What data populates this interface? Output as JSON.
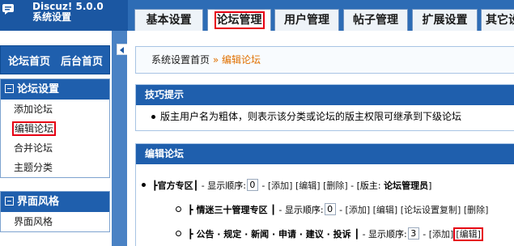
{
  "header": {
    "app_title": "Discuz! 5.0.0",
    "app_subtitle": "系统设置",
    "tabs": [
      {
        "label": "基本设置"
      },
      {
        "label": "论坛管理"
      },
      {
        "label": "用户管理"
      },
      {
        "label": "帖子管理"
      },
      {
        "label": "扩展设置"
      },
      {
        "label": "其它设"
      }
    ],
    "active_tab": "论坛管理"
  },
  "sidebar": {
    "links": [
      "论坛首页",
      "后台首页"
    ],
    "sections": [
      {
        "title": "论坛设置",
        "items": [
          "添加论坛",
          "编辑论坛",
          "合并论坛",
          "主题分类"
        ],
        "selected": "编辑论坛"
      },
      {
        "title": "界面风格",
        "items": [
          "界面风格"
        ]
      }
    ]
  },
  "main": {
    "breadcrumb": {
      "home": "系统设置首页",
      "separator": "»",
      "current": "编辑论坛"
    },
    "tip_panel": {
      "title": "技巧提示",
      "text": "版主用户名为粗体，则表示该分类或论坛的版主权限可继承到下级论坛"
    },
    "forum_panel": {
      "title": "编辑论坛",
      "rows": [
        {
          "name": "┣官方专区┃",
          "order_label": " - 显示顺序:",
          "order": "0",
          "actions": [
            "[添加]",
            "[编辑]",
            "[删除]"
          ],
          "mod_prefix": " - [版主: ",
          "mod_name": "论坛管理员",
          "mod_suffix": "]"
        },
        {
          "name": "┣ 情迷三十管理专区 ┃",
          "order_label": " - 显示顺序:",
          "order": "0",
          "actions": [
            "[添加]",
            "[编辑]",
            "[论坛设置复制]",
            "[删除]"
          ]
        },
        {
          "name": "┣ 公告 · 规定 · 新闻 · 申请 · 建议 · 投诉 ┃",
          "order_label": " - 显示顺序:",
          "order": "3",
          "actions": [
            "[添加]",
            "[编辑]"
          ]
        }
      ]
    }
  },
  "colors": {
    "header_bg": "#2d6cb5",
    "panel_head": "#1f5fad",
    "highlight_box": "#e60012",
    "breadcrumb_current": "#e07000"
  }
}
